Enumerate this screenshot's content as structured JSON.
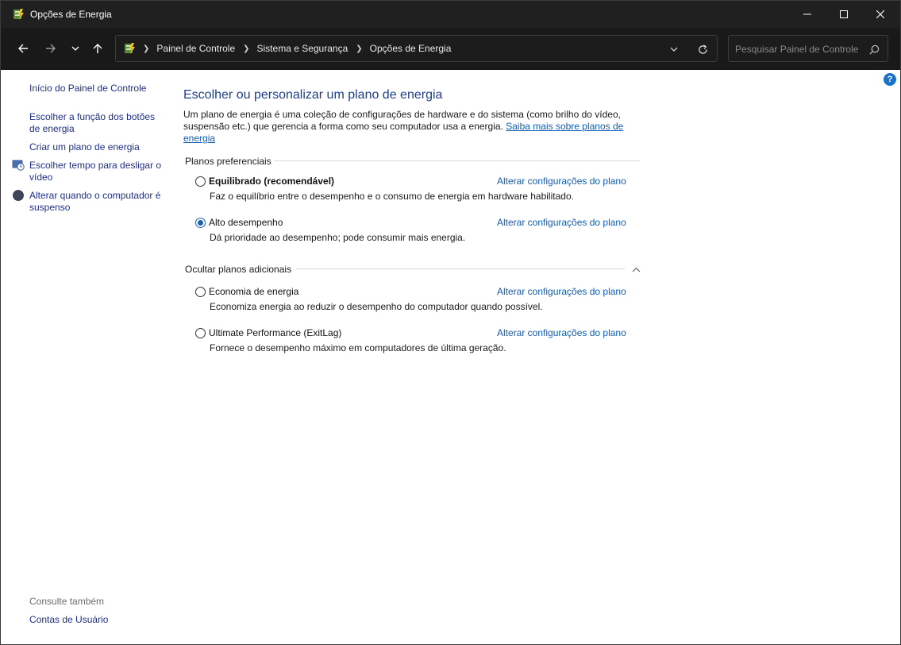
{
  "window": {
    "title": "Opções de Energia",
    "minimize_glyph": "—",
    "maximize_glyph": "☐",
    "close_glyph": "✕"
  },
  "address_bar": {
    "breadcrumbs": [
      "Painel de Controle",
      "Sistema e Segurança",
      "Opções de Energia"
    ]
  },
  "search": {
    "placeholder": "Pesquisar Painel de Controle"
  },
  "help": {
    "label": "?"
  },
  "sidebar": {
    "home_link": "Início do Painel de Controle",
    "links": [
      "Escolher a função dos botões de energia",
      "Criar um plano de energia",
      "Escolher tempo para desligar o vídeo",
      "Alterar quando o computador é suspenso"
    ],
    "see_also_label": "Consulte também",
    "see_also_links": [
      "Contas de Usuário"
    ]
  },
  "main": {
    "title": "Escolher ou personalizar um plano de energia",
    "intro_text": "Um plano de energia é uma coleção de configurações de hardware e do sistema (como brilho do vídeo, suspensão etc.) que gerencia a forma como seu computador usa a energia. ",
    "intro_link": "Saiba mais sobre planos de energia",
    "preferred_header": "Planos preferenciais",
    "hidden_header": "Ocultar planos adicionais",
    "change_link": "Alterar configurações do plano",
    "preferred_plans": [
      {
        "name": "Equilibrado (recomendável)",
        "description": "Faz o equilíbrio entre o desempenho e o consumo de energia em hardware habilitado.",
        "selected": false
      },
      {
        "name": "Alto desempenho",
        "description": "Dá prioridade ao desempenho; pode consumir mais energia.",
        "selected": true
      }
    ],
    "additional_plans": [
      {
        "name": "Economia de energia",
        "description": "Economiza energia ao reduzir o desempenho do computador quando possível.",
        "selected": false
      },
      {
        "name": "Ultimate Performance (ExitLag)",
        "description": "Fornece o desempenho máximo em computadores de última geração.",
        "selected": false
      }
    ]
  },
  "colors": {
    "titlebar": "#202020",
    "link": "#0f5cb8",
    "sidebar_link": "#1e2f8a",
    "heading": "#1e3e8c"
  }
}
